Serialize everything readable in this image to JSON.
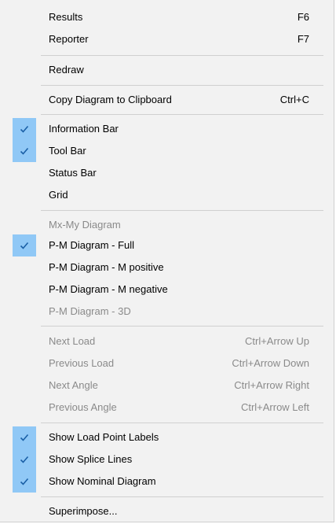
{
  "menu": {
    "items": [
      {
        "label": "Results",
        "shortcut": "F6"
      },
      {
        "label": "Reporter",
        "shortcut": "F7"
      },
      {
        "label": "Redraw",
        "shortcut": ""
      },
      {
        "label": "Copy Diagram to Clipboard",
        "shortcut": "Ctrl+C"
      },
      {
        "label": "Information Bar",
        "shortcut": "",
        "checked": true
      },
      {
        "label": "Tool Bar",
        "shortcut": "",
        "checked": true
      },
      {
        "label": "Status Bar",
        "shortcut": ""
      },
      {
        "label": "Grid",
        "shortcut": ""
      },
      {
        "label": "Mx-My Diagram",
        "shortcut": "",
        "disabled": true
      },
      {
        "label": "P-M Diagram - Full",
        "shortcut": "",
        "checked": true
      },
      {
        "label": "P-M Diagram - M positive",
        "shortcut": ""
      },
      {
        "label": "P-M Diagram - M negative",
        "shortcut": ""
      },
      {
        "label": "P-M Diagram - 3D",
        "shortcut": "",
        "disabled": true
      },
      {
        "label": "Next Load",
        "shortcut": "Ctrl+Arrow Up",
        "disabled": true
      },
      {
        "label": "Previous Load",
        "shortcut": "Ctrl+Arrow Down",
        "disabled": true
      },
      {
        "label": "Next Angle",
        "shortcut": "Ctrl+Arrow Right",
        "disabled": true
      },
      {
        "label": "Previous Angle",
        "shortcut": "Ctrl+Arrow Left",
        "disabled": true
      },
      {
        "label": "Show Load Point Labels",
        "shortcut": "",
        "checked": true
      },
      {
        "label": "Show Splice Lines",
        "shortcut": "",
        "checked": true
      },
      {
        "label": "Show Nominal Diagram",
        "shortcut": "",
        "checked": true
      },
      {
        "label": "Superimpose...",
        "shortcut": ""
      }
    ],
    "colors": {
      "check_highlight": "#90c8f6",
      "check_mark": "#1a5fa6",
      "disabled_text": "#8a8a8a"
    },
    "icons": {
      "checked": "checkmark-icon"
    }
  }
}
